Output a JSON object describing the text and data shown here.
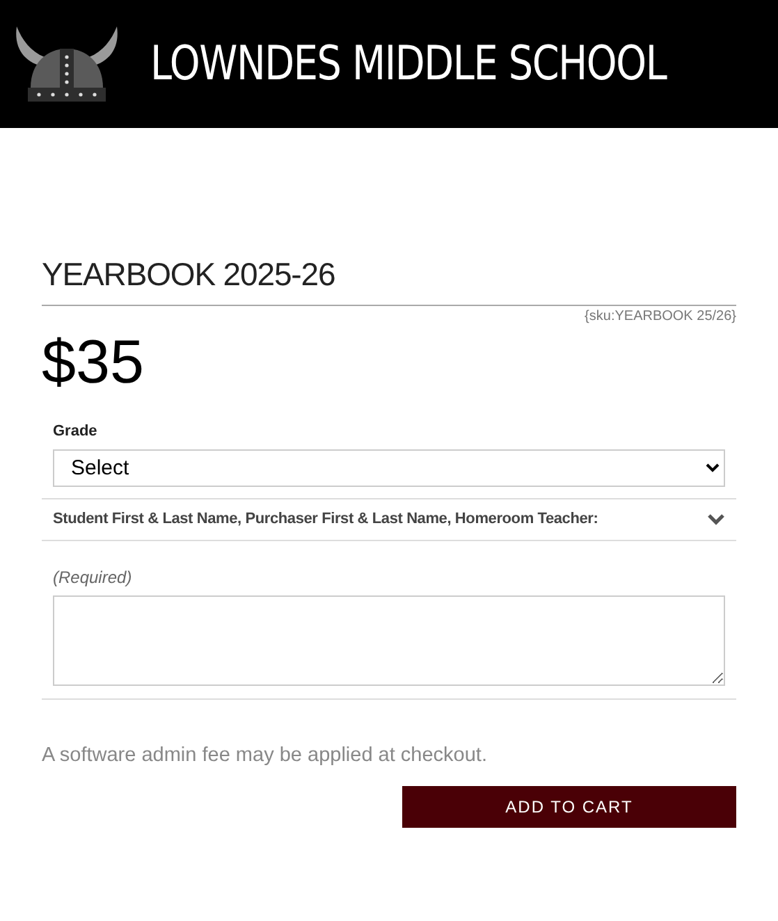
{
  "header": {
    "school_name": "LOWNDES MIDDLE SCHOOL"
  },
  "product": {
    "title": "YEARBOOK 2025-26",
    "sku": "{sku:YEARBOOK 25/26}",
    "price": "$35"
  },
  "grade": {
    "label": "Grade",
    "value": "Select"
  },
  "details": {
    "heading": "Student First & Last Name, Purchaser First & Last Name, Homeroom Teacher:",
    "hint": "(Required)"
  },
  "fee_note": "A software admin fee may be applied at checkout.",
  "add_to_cart": "ADD TO CART"
}
